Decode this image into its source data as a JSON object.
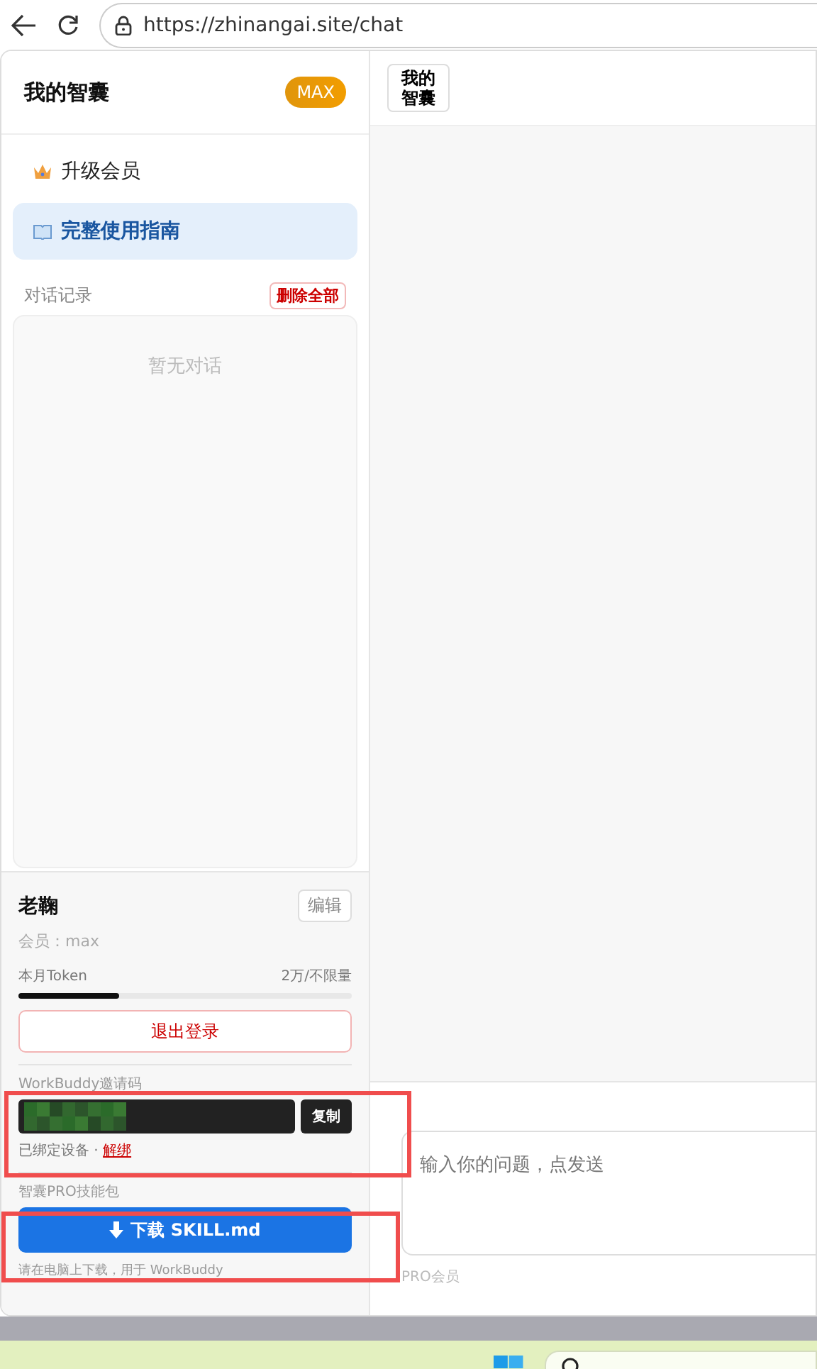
{
  "browser": {
    "url": "https://zhinangai.site/chat"
  },
  "sidebar": {
    "title": "我的智囊",
    "plan_badge": "MAX",
    "menu": [
      {
        "label": "升级会员",
        "selected": false
      },
      {
        "label": "完整使用指南",
        "selected": true
      }
    ],
    "history": {
      "title": "对话记录",
      "delete_all": "删除全部",
      "empty_text": "暂无对话"
    },
    "user": {
      "name": "老鞠",
      "edit": "编辑",
      "membership": "会员：max",
      "token_label": "本月Token",
      "token_quota": "2万/不限量",
      "level": 0.3,
      "logout": "退出登录"
    },
    "invite": {
      "title": "WorkBuddy邀请码",
      "copy": "复制",
      "bound_text": "已绑定设备 · ",
      "unbind": "解绑"
    },
    "skill_pack": {
      "title": "智囊PRO技能包",
      "download": "下载 SKILL.md",
      "note": "请在电脑上下载，用于 WorkBuddy"
    }
  },
  "main": {
    "header_button": "我的智囊",
    "input": {
      "placeholder": "输入你的问题，点发送"
    },
    "footer_text": "PRO会员"
  }
}
